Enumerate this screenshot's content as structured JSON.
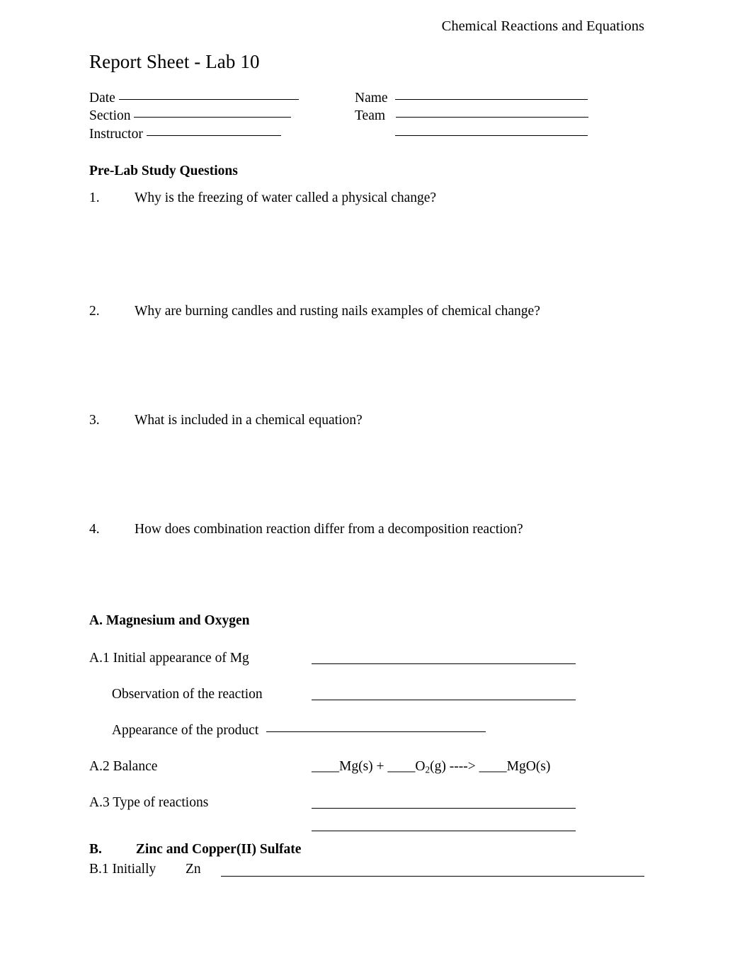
{
  "document": {
    "running_head": "Chemical Reactions and Equations",
    "title": "Report Sheet - Lab 10"
  },
  "identity": {
    "left_fields": [
      {
        "label": "Date",
        "rule_width": 254
      },
      {
        "label": "Section",
        "rule_width": 222
      },
      {
        "label": "Instructor",
        "rule_width": 190
      }
    ],
    "right_fields": [
      {
        "label": "Name",
        "rule_width": 272
      },
      {
        "label": "Team",
        "rule_width": 272
      },
      {
        "label": "",
        "rule_width": 272
      }
    ]
  },
  "prelab": {
    "heading": "Pre-Lab Study Questions",
    "questions": [
      {
        "num": "1.",
        "text": "Why is the freezing of water called a physical change?"
      },
      {
        "num": "2.",
        "text": "Why are burning candles and rusting nails examples of chemical change?"
      },
      {
        "num": "3.",
        "text": "What is included in a chemical equation?"
      },
      {
        "num": "4.",
        "text": "How does combination reaction differ from a decomposition reaction?"
      }
    ]
  },
  "part_a": {
    "heading": "A. Magnesium and Oxygen",
    "a1_label": "A.1 Initial appearance of Mg",
    "observation_label": "Observation of the reaction",
    "appearance_label": "Appearance of the product",
    "a2_label": "A.2 Balance",
    "a3_label": "A.3 Type of reactions",
    "equation": {
      "blank1": "____",
      "reactant1": "Mg(s)",
      "plus": " + ",
      "blank2": "____",
      "reactant2_base": "O",
      "reactant2_sub": "2",
      "reactant2_state": "(g)",
      "arrow": " ----> ",
      "blank3": "____",
      "product": "MgO(s)"
    }
  },
  "part_b": {
    "heading_letter": "B.",
    "heading_text": "Zinc and Copper(II) Sulfate",
    "b1_label": "B.1 Initially",
    "b1_symbol": "Zn"
  }
}
